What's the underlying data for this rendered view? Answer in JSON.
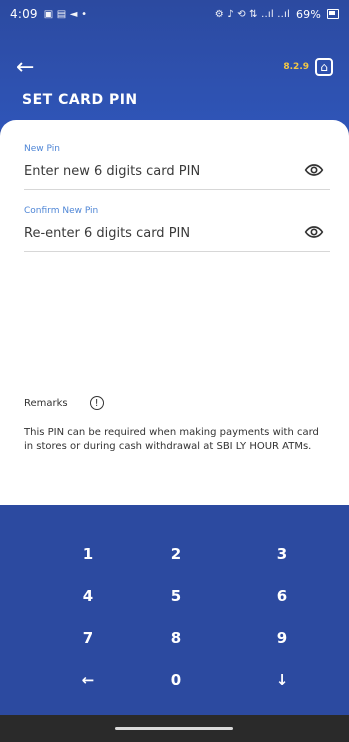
{
  "status_bar": {
    "time": "4:09",
    "left_icons": [
      "notification-icons"
    ],
    "right_icons_text": "⚙ ♪ ⟲ ⇅ ..ıl ..ıl",
    "battery": "69%"
  },
  "header": {
    "version": "8.2.9",
    "title": "SET CARD PIN"
  },
  "form": {
    "new_pin": {
      "label": "New Pin",
      "placeholder": "Enter new 6 digits card PIN"
    },
    "confirm_pin": {
      "label": "Confirm New Pin",
      "placeholder": "Re-enter 6 digits card PIN"
    },
    "remarks_label": "Remarks",
    "note": "This PIN can be required when making payments with card in stores or during cash withdrawal at SBI LY HOUR ATMs."
  },
  "keypad": {
    "keys": [
      "1",
      "2",
      "3",
      "4",
      "5",
      "6",
      "7",
      "8",
      "9",
      "←",
      "0",
      "↓"
    ]
  },
  "colors": {
    "primary": "#2c4aa0",
    "accent": "#f3c845",
    "label_blue": "#4f86d6"
  }
}
